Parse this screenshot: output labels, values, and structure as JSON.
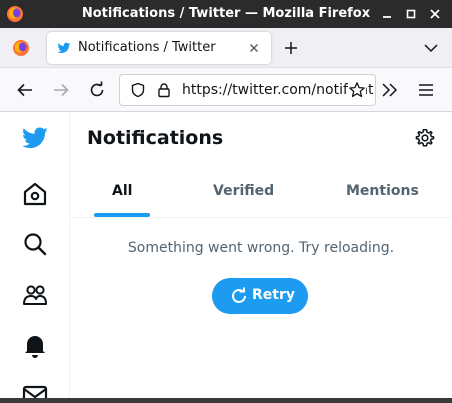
{
  "window": {
    "title": "Notifications / Twitter — Mozilla Firefox"
  },
  "browser": {
    "tab": {
      "label": "Notifications / Twitter"
    },
    "url": "https://twitter.com/notificat",
    "colors": {
      "titlebar": "#2b2b2b",
      "tabstrip": "#f0f0f4"
    }
  },
  "twitter": {
    "page_title": "Notifications",
    "tabs": [
      {
        "label": "All",
        "selected": true
      },
      {
        "label": "Verified",
        "selected": false
      },
      {
        "label": "Mentions",
        "selected": false
      }
    ],
    "error_message": "Something went wrong. Try reloading.",
    "retry_label": "Retry",
    "sidebar_icons": [
      "twitter-logo-icon",
      "home-icon",
      "search-icon",
      "communities-icon",
      "bell-icon",
      "mail-icon"
    ],
    "colors": {
      "accent": "#1d9bf0",
      "text": "#0f1419",
      "secondary": "#536471"
    }
  }
}
